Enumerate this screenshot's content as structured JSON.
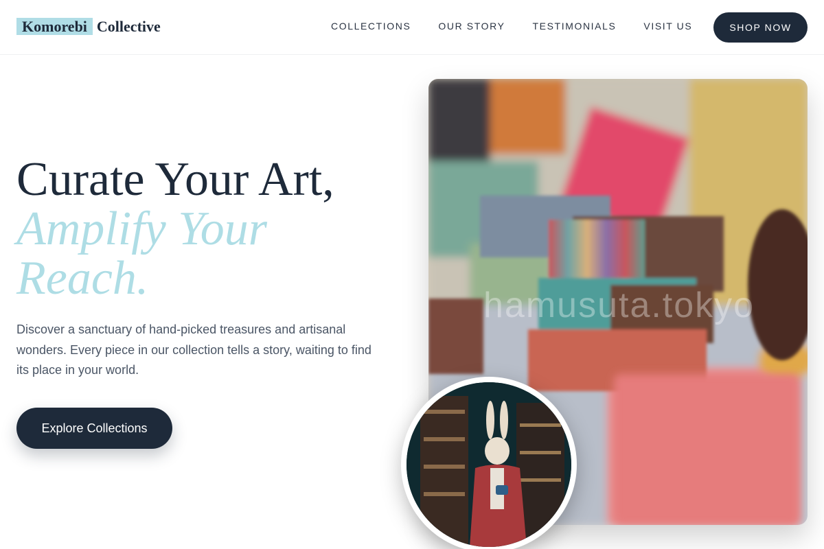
{
  "brand": {
    "highlight": "Komorebi",
    "rest": "Collective"
  },
  "nav": {
    "items": [
      "COLLECTIONS",
      "OUR STORY",
      "TESTIMONIALS",
      "VISIT US"
    ],
    "shop_label": "SHOP NOW"
  },
  "hero": {
    "headline_line1": "Curate Your Art,",
    "headline_line2": "Amplify Your Reach.",
    "lead": "Discover a sanctuary of hand-picked treasures and artisanal wonders. Every piece in our collection tells a story, waiting to find its place in your world.",
    "cta_label": "Explore Collections"
  },
  "images": {
    "watermark": "hamusuta.tokyo"
  },
  "colors": {
    "navy": "#1e2a3a",
    "accent": "#aedde5",
    "text_muted": "#4a5565"
  }
}
